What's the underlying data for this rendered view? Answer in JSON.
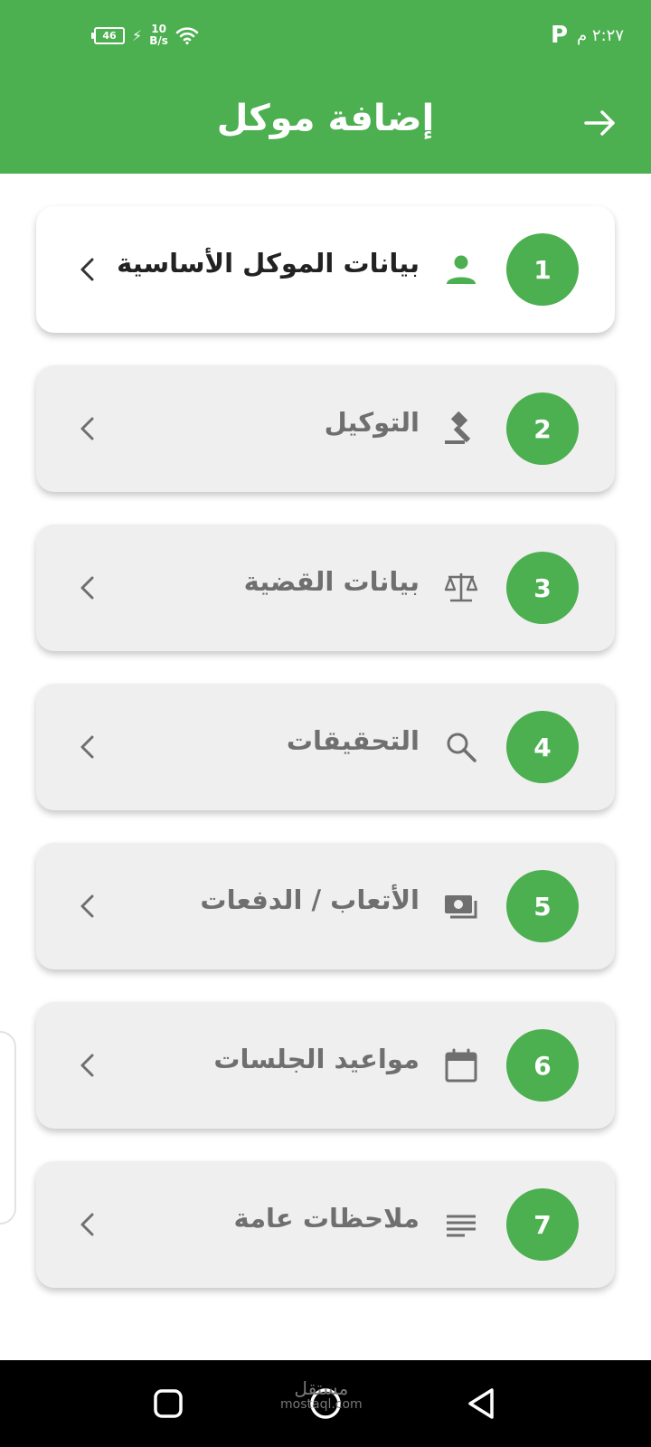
{
  "status_bar": {
    "battery": "46",
    "net_speed_value": "10",
    "net_speed_unit": "B/s",
    "time": "٢:٢٧ م",
    "parking_badge": "P"
  },
  "header": {
    "title": "إضافة موكل",
    "back_icon": "arrow-right-icon"
  },
  "colors": {
    "primary": "#4caf50",
    "card_active": "#ffffff",
    "card_inactive": "#efefef"
  },
  "steps": [
    {
      "number": "1",
      "label": "بيانات الموكل الأساسية",
      "icon": "person-icon",
      "active": true
    },
    {
      "number": "2",
      "label": "التوكيل",
      "icon": "gavel-icon",
      "active": false
    },
    {
      "number": "3",
      "label": "بيانات القضية",
      "icon": "scale-icon",
      "active": false
    },
    {
      "number": "4",
      "label": "التحقيقات",
      "icon": "search-icon",
      "active": false
    },
    {
      "number": "5",
      "label": "الأتعاب / الدفعات",
      "icon": "payments-icon",
      "active": false
    },
    {
      "number": "6",
      "label": "مواعيد الجلسات",
      "icon": "calendar-icon",
      "active": false
    },
    {
      "number": "7",
      "label": "ملاحظات عامة",
      "icon": "notes-icon",
      "active": false
    }
  ],
  "nav_bar": {
    "buttons": [
      "recents-icon",
      "home-icon",
      "back-icon"
    ],
    "watermark_top": "مستقل",
    "watermark_bottom": "mostaql.com"
  }
}
